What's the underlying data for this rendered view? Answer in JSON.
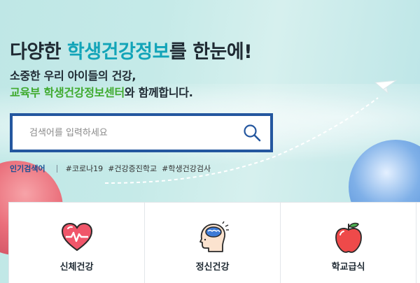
{
  "hero": {
    "headline_pre": "다양한 ",
    "headline_highlight": "학생건강정보",
    "headline_post": "를 한눈에!",
    "sub_line1": "소중한 우리 아이들의 건강,",
    "sub_line2_green": "교육부 학생건강정보센터",
    "sub_line2_post": "와 함께합니다."
  },
  "search": {
    "placeholder": "검색어를 입력하세요",
    "value": ""
  },
  "popular": {
    "label": "인기검색어",
    "tags": [
      "#코로나19",
      "#건강증진학교",
      "#학생건강검사"
    ]
  },
  "cards": [
    {
      "label": "신체건강",
      "icon": "heart-pulse-icon"
    },
    {
      "label": "정신건강",
      "icon": "head-brain-icon"
    },
    {
      "label": "학교급식",
      "icon": "apple-icon"
    }
  ],
  "colors": {
    "accent_teal": "#12a4b8",
    "accent_green": "#3faa2e",
    "search_border": "#24579f",
    "popular_label": "#1b4f93"
  }
}
